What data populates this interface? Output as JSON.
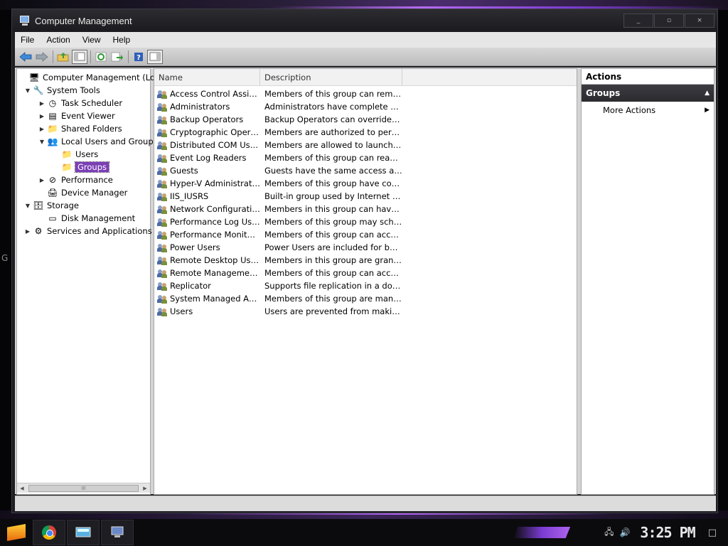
{
  "window": {
    "title": "Computer Management",
    "minimize": "_",
    "maximize": "▫",
    "close": "×"
  },
  "menu": [
    "File",
    "Action",
    "View",
    "Help"
  ],
  "toolbar": {
    "buttons": [
      "back-icon",
      "forward-icon",
      "up-folder-icon",
      "show-hide-console-tree-icon",
      "refresh-icon",
      "export-list-icon",
      "help-icon",
      "show-hide-action-pane-icon"
    ]
  },
  "tree": {
    "items": [
      {
        "label": "Computer Management (Local)",
        "icon": "computer-management-icon",
        "level": 0,
        "expander": ""
      },
      {
        "label": "System Tools",
        "icon": "system-tools-icon",
        "level": 1,
        "expander": "▼"
      },
      {
        "label": "Task Scheduler",
        "icon": "clock-icon",
        "level": 2,
        "expander": "▶"
      },
      {
        "label": "Event Viewer",
        "icon": "event-viewer-icon",
        "level": 2,
        "expander": "▶"
      },
      {
        "label": "Shared Folders",
        "icon": "shared-folder-icon",
        "level": 2,
        "expander": "▶"
      },
      {
        "label": "Local Users and Groups",
        "icon": "users-groups-icon",
        "level": 2,
        "expander": "▼"
      },
      {
        "label": "Users",
        "icon": "folder-icon",
        "level": 3,
        "expander": ""
      },
      {
        "label": "Groups",
        "icon": "folder-icon",
        "level": 3,
        "expander": "",
        "selected": true
      },
      {
        "label": "Performance",
        "icon": "performance-icon",
        "level": 2,
        "expander": "▶"
      },
      {
        "label": "Device Manager",
        "icon": "device-manager-icon",
        "level": 2,
        "expander": ""
      },
      {
        "label": "Storage",
        "icon": "storage-icon",
        "level": 1,
        "expander": "▼"
      },
      {
        "label": "Disk Management",
        "icon": "disk-icon",
        "level": 2,
        "expander": ""
      },
      {
        "label": "Services and Applications",
        "icon": "services-icon",
        "level": 1,
        "expander": "▶"
      }
    ],
    "scroll_thumb": "III"
  },
  "list": {
    "columns": {
      "name": "Name",
      "description": "Description"
    },
    "rows": [
      {
        "name": "Access Control Assistan...",
        "description": "Members of this group can remotely ..."
      },
      {
        "name": "Administrators",
        "description": "Administrators have complete and un..."
      },
      {
        "name": "Backup Operators",
        "description": "Backup Operators can override secu..."
      },
      {
        "name": "Cryptographic Operators",
        "description": "Members are authorized to perform c..."
      },
      {
        "name": "Distributed COM Users",
        "description": "Members are allowed to launch, activ..."
      },
      {
        "name": "Event Log Readers",
        "description": "Members of this group can read eve..."
      },
      {
        "name": "Guests",
        "description": "Guests have the same access as me..."
      },
      {
        "name": "Hyper-V Administrators",
        "description": "Members of this group have complet..."
      },
      {
        "name": "IIS_IUSRS",
        "description": "Built-in group used by Internet Infor..."
      },
      {
        "name": "Network Configuration ...",
        "description": "Members in this group can have som..."
      },
      {
        "name": "Performance Log Users",
        "description": "Members of this group may schedule ..."
      },
      {
        "name": "Performance Monitor Us...",
        "description": "Members of this group can access pe..."
      },
      {
        "name": "Power Users",
        "description": "Power Users are included for backw..."
      },
      {
        "name": "Remote Desktop Users",
        "description": "Members in this group are granted th..."
      },
      {
        "name": "Remote Management U...",
        "description": "Members of this group can access W..."
      },
      {
        "name": "Replicator",
        "description": "Supports file replication in a domain"
      },
      {
        "name": "System Managed Accou...",
        "description": "Members of this group are managed ..."
      },
      {
        "name": "Users",
        "description": "Users are prevented from making ac..."
      }
    ]
  },
  "actions": {
    "title": "Actions",
    "section": "Groups",
    "items": [
      "More Actions"
    ]
  },
  "desktop": {
    "left_glyph": "G"
  },
  "taskbar": {
    "pinned": [
      "chrome-icon",
      "computer-management-icon",
      "network-icon"
    ],
    "clock": "3:25 PM",
    "tray_icons": [
      "network-tray-icon",
      "volume-tray-icon"
    ],
    "notification": "□"
  },
  "colors": {
    "selection": "#7b3fb6",
    "accent": "#b063f0"
  }
}
